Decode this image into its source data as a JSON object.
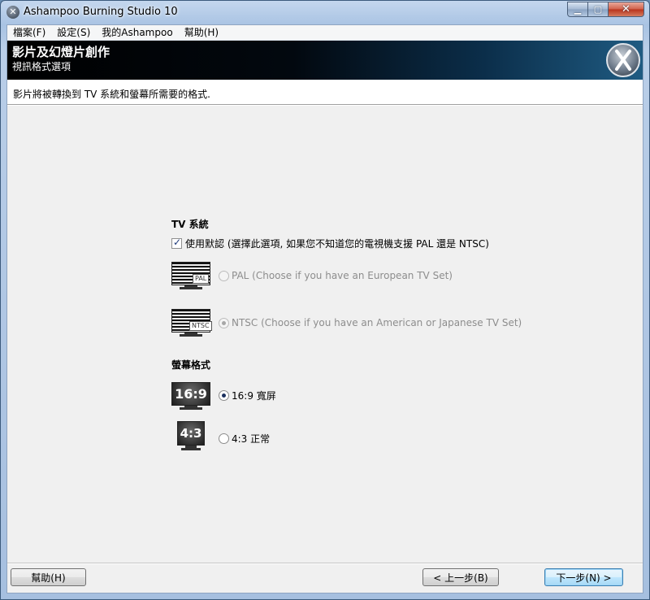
{
  "window": {
    "title": "Ashampoo Burning Studio 10"
  },
  "menu": {
    "items": [
      "檔案(F)",
      "設定(S)",
      "我的Ashampoo",
      "幫助(H)"
    ]
  },
  "banner": {
    "title": "影片及幻燈片創作",
    "subtitle": "視訊格式選項"
  },
  "description": "影片將被轉換到 TV 系統和螢幕所需要的格式.",
  "tv_system": {
    "heading": "TV 系統",
    "use_default": {
      "label": "使用默認 (選擇此選項, 如果您不知道您的電視機支援 PAL 還是 NTSC)",
      "checked": true
    },
    "options": [
      {
        "label": "PAL (Choose if you have an European TV Set)",
        "badge": "PAL",
        "selected": false,
        "enabled": false
      },
      {
        "label": "NTSC (Choose if you have an American or Japanese TV Set)",
        "badge": "NTSC",
        "selected": true,
        "enabled": false
      }
    ]
  },
  "screen_format": {
    "heading": "螢幕格式",
    "options": [
      {
        "label": "16:9 寬屏",
        "badge": "16:9",
        "selected": true
      },
      {
        "label": "4:3 正常",
        "badge": "4:3",
        "selected": false
      }
    ]
  },
  "buttons": {
    "help": "幫助(H)",
    "back": "< 上一步(B)",
    "next": "下一步(N) >"
  }
}
